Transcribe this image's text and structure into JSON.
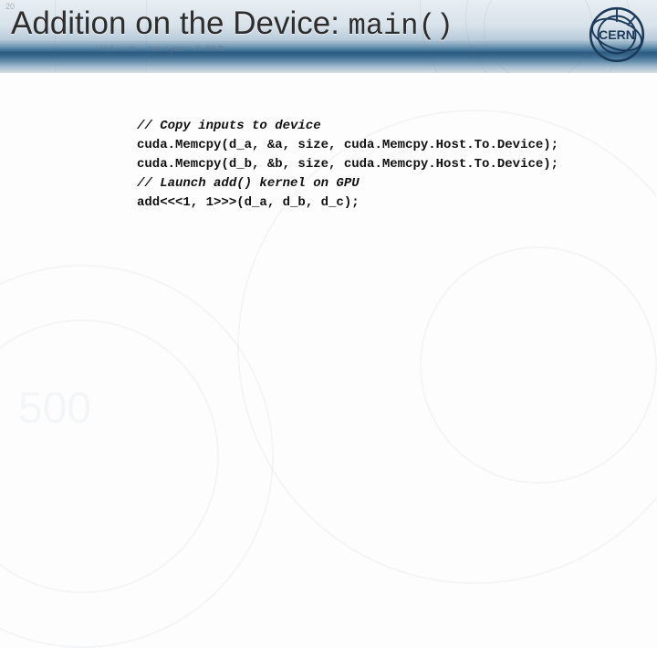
{
  "header": {
    "title_prefix": "Addition on the Device: ",
    "title_mono": "main()",
    "bg_subtext": "H,A → ττ → two τ jets + X, 60 fb",
    "bg_tick": "20"
  },
  "code": {
    "lines": [
      {
        "t": "comment",
        "v": "// Copy inputs to device"
      },
      {
        "t": "code",
        "v": "cuda.Memcpy(d_a, &a, size, cuda.Memcpy.Host.To.Device);"
      },
      {
        "t": "code",
        "v": "cuda.Memcpy(d_b, &b, size, cuda.Memcpy.Host.To.Device);"
      },
      {
        "t": "comment",
        "v": "// Launch add() kernel on GPU"
      },
      {
        "t": "code",
        "v": "add<<<1, 1>>>(d_a, d_b, d_c);"
      }
    ]
  },
  "logo": {
    "text": "CERN"
  }
}
